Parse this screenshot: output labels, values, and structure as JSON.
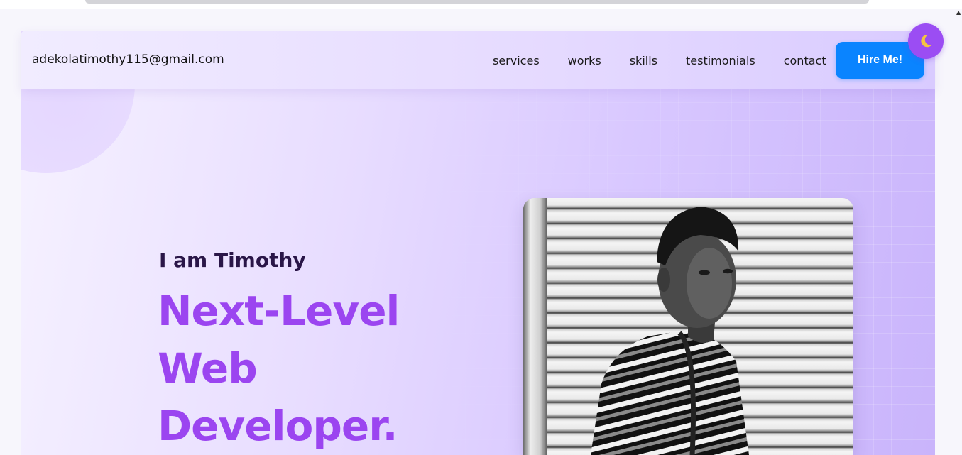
{
  "nav": {
    "email": "adekolatimothy115@gmail.com",
    "links": [
      "services",
      "works",
      "skills",
      "testimonials",
      "contact"
    ],
    "hire_label": "Hire Me!",
    "theme_icon": "moon-icon"
  },
  "hero": {
    "intro": "I am Timothy",
    "headline_lines": [
      "Next-Level",
      "Web",
      "Developer."
    ],
    "photo_icon": "portrait-photo"
  },
  "colors": {
    "accent_purple": "#9b45f0",
    "button_blue": "#0a84ff",
    "toggle_purple": "#9b4df3",
    "intro_dark": "#2a1648"
  }
}
